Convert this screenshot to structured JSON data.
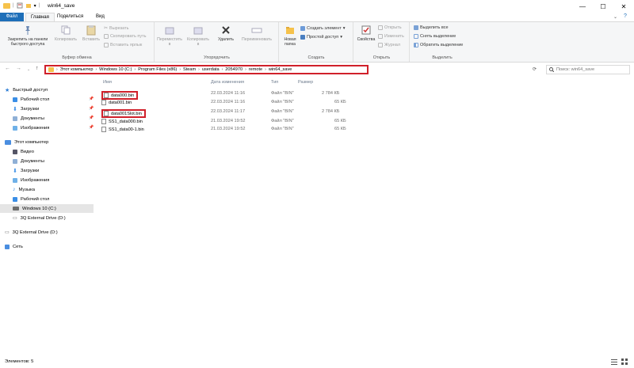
{
  "window": {
    "title": "win64_save",
    "controls": {
      "minimize": "—",
      "maximize": "☐",
      "close": "✕"
    }
  },
  "ribbon_tabs": [
    {
      "label": "Файл"
    },
    {
      "label": "Главная"
    },
    {
      "label": "Поделиться"
    },
    {
      "label": "Вид"
    }
  ],
  "ribbon": {
    "clipboard": {
      "pin_label": "Закрепить на панели быстрого доступа",
      "copy_label": "Копировать",
      "paste_label": "Вставить",
      "cut_label": "Вырезать",
      "copy_path_label": "Скопировать путь",
      "paste_shortcut_label": "Вставить ярлык",
      "group_label": "Буфер обмена"
    },
    "organize": {
      "move_label": "Переместить в",
      "copy_to_label": "Копировать в",
      "delete_label": "Удалить",
      "rename_label": "Переименовать",
      "group_label": "Упорядочить"
    },
    "new": {
      "new_folder_label": "Новая папка",
      "new_item_label": "Создать элемент",
      "easy_access_label": "Простой доступ",
      "group_label": "Создать"
    },
    "open": {
      "properties_label": "Свойства",
      "open_label": "Открыть",
      "edit_label": "Изменить",
      "history_label": "Журнал",
      "group_label": "Открыть"
    },
    "select": {
      "select_all_label": "Выделить все",
      "select_none_label": "Снять выделение",
      "invert_label": "Обратить выделение",
      "group_label": "Выделить"
    }
  },
  "address": {
    "breadcrumbs": [
      "Этот компьютер",
      "Windows 10 (C:)",
      "Program Files (x86)",
      "Steam",
      "userdata",
      "2054970",
      "remote",
      "win64_save"
    ],
    "search_placeholder": "Поиск: win64_save"
  },
  "nav": {
    "quick_access": "Быстрый доступ",
    "quick_items": [
      "Рабочий стол",
      "Загрузки",
      "Документы",
      "Изображения"
    ],
    "this_pc": "Этот компьютер",
    "pc_items": [
      "Видео",
      "Документы",
      "Загрузки",
      "Изображения",
      "Музыка",
      "Рабочий стол",
      "Windows 10 (C:)",
      "3Q External Drive (D:)"
    ],
    "external": "3Q External Drive (D:)",
    "network": "Сеть"
  },
  "columns": {
    "name": "Имя",
    "date": "Дата изменения",
    "type": "Тип",
    "size": "Размер"
  },
  "files": [
    {
      "name": "data000.bin",
      "date": "22.03.2024 11:16",
      "type": "Файл \"BIN\"",
      "size": "2 784 КБ"
    },
    {
      "name": "data001.bin",
      "date": "22.03.2024 11:16",
      "type": "Файл \"BIN\"",
      "size": "65 КБ"
    },
    {
      "name": "data001Slot.bin",
      "date": "22.03.2024 11:17",
      "type": "Файл \"BIN\"",
      "size": "2 784 КБ"
    },
    {
      "name": "SS1_data000.bin",
      "date": "21.03.2024 19:52",
      "type": "Файл \"BIN\"",
      "size": "65 КБ"
    },
    {
      "name": "SS1_data00-1.bin",
      "date": "21.03.2024 19:52",
      "type": "Файл \"BIN\"",
      "size": "65 КБ"
    }
  ],
  "status": {
    "items_text": "Элементов: 5"
  },
  "colors": {
    "file_tab": "#1e6fb9",
    "highlight": "#d0202a",
    "selected_nav": "#e5e5e5"
  }
}
